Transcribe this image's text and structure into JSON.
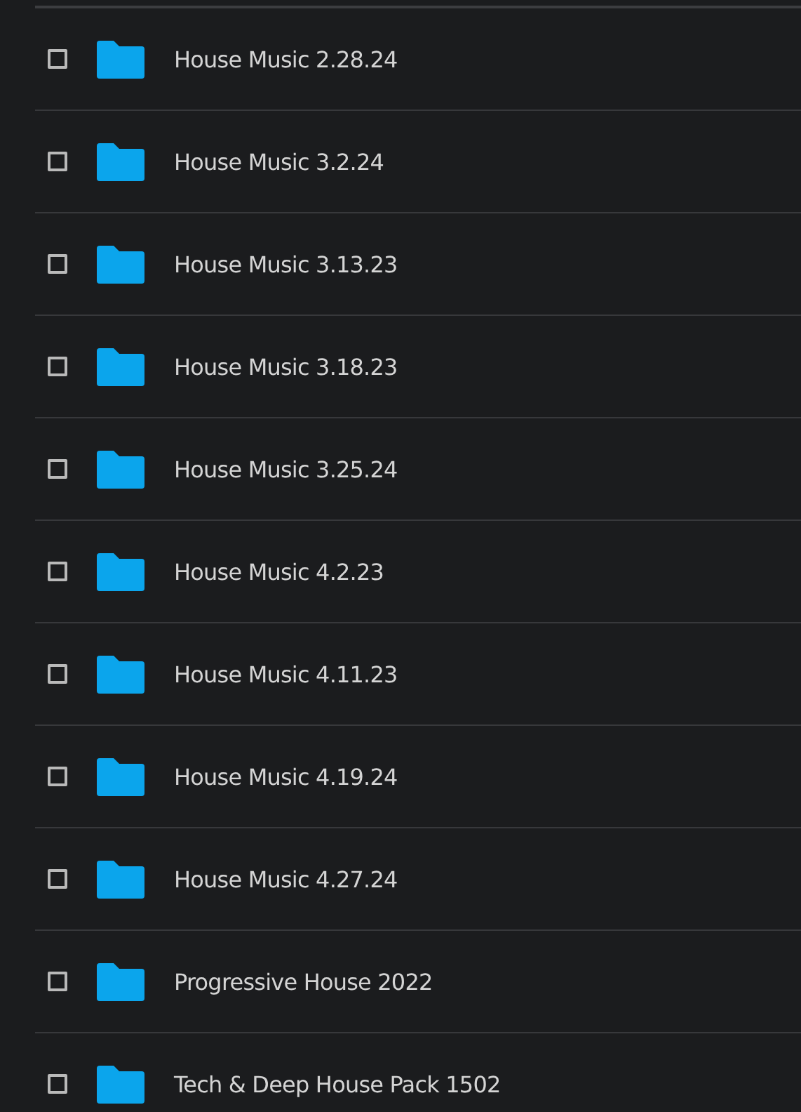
{
  "files": [
    {
      "name": "House Music 2.28.24",
      "checked": false
    },
    {
      "name": "House Music 3.2.24",
      "checked": false
    },
    {
      "name": "House Music 3.13.23",
      "checked": false
    },
    {
      "name": "House Music 3.18.23",
      "checked": false
    },
    {
      "name": "House Music 3.25.24",
      "checked": false
    },
    {
      "name": "House Music 4.2.23",
      "checked": false
    },
    {
      "name": "House Music 4.11.23",
      "checked": false
    },
    {
      "name": "House Music 4.19.24",
      "checked": false
    },
    {
      "name": "House Music 4.27.24",
      "checked": false
    },
    {
      "name": "Progressive House 2022",
      "checked": false
    },
    {
      "name": "Tech & Deep House Pack 1502",
      "checked": false
    }
  ]
}
